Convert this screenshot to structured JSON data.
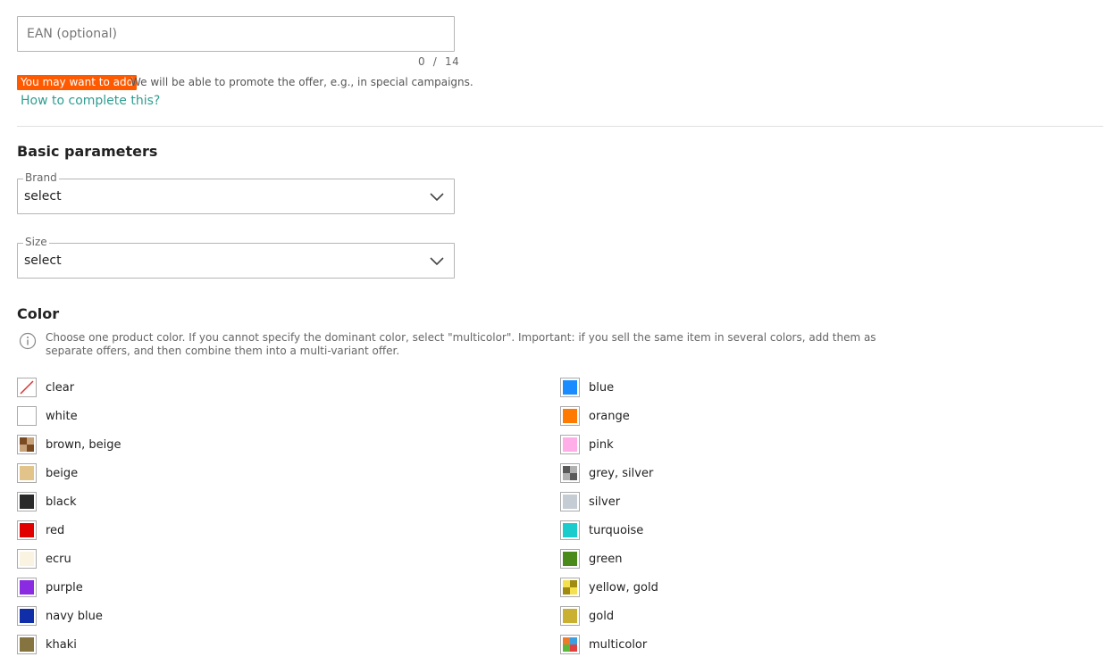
{
  "ean": {
    "placeholder": "EAN (optional)",
    "value": "",
    "counter_current": "0",
    "counter_sep": "/",
    "counter_max": "14",
    "badge": "You may want to add",
    "note": "We will be able to promote the offer, e.g., in special campaigns.",
    "help_link": "How to complete this?"
  },
  "basic_parameters": {
    "title": "Basic parameters",
    "brand": {
      "legend": "Brand",
      "value": "select"
    },
    "size": {
      "legend": "Size",
      "value": "select"
    }
  },
  "color": {
    "title": "Color",
    "info": "Choose one product color. If you cannot specify the dominant color, select \"multicolor\". Important: if you sell the same item in several colors, add them as separate offers, and then combine them into a multi-variant offer.",
    "options": [
      {
        "label": "clear",
        "swatch": "clear-icon",
        "colors": [
          "#ffffff",
          "#e03030"
        ]
      },
      {
        "label": "white",
        "swatch": "solid",
        "colors": [
          "#ffffff"
        ]
      },
      {
        "label": "brown, beige",
        "swatch": "checker",
        "colors": [
          "#7a4a22",
          "#c8a27a"
        ]
      },
      {
        "label": "beige",
        "swatch": "solid",
        "colors": [
          "#e2c48a"
        ]
      },
      {
        "label": "black",
        "swatch": "solid",
        "colors": [
          "#2a2a2a"
        ]
      },
      {
        "label": "red",
        "swatch": "solid",
        "colors": [
          "#e00000"
        ]
      },
      {
        "label": "ecru",
        "swatch": "solid",
        "colors": [
          "#fbf3e2"
        ]
      },
      {
        "label": "purple",
        "swatch": "solid",
        "colors": [
          "#8a2be2"
        ]
      },
      {
        "label": "navy blue",
        "swatch": "solid",
        "colors": [
          "#0f2ea8"
        ]
      },
      {
        "label": "khaki",
        "swatch": "solid",
        "colors": [
          "#857340"
        ]
      },
      {
        "label": "blue",
        "swatch": "solid",
        "colors": [
          "#1a8cff"
        ]
      },
      {
        "label": "orange",
        "swatch": "solid",
        "colors": [
          "#ff7a00"
        ]
      },
      {
        "label": "pink",
        "swatch": "solid",
        "colors": [
          "#ffaee8"
        ]
      },
      {
        "label": "grey, silver",
        "swatch": "checker",
        "colors": [
          "#5a5a5a",
          "#b0b0b0"
        ]
      },
      {
        "label": "silver",
        "swatch": "solid",
        "colors": [
          "#c5ccd4"
        ]
      },
      {
        "label": "turquoise",
        "swatch": "solid",
        "colors": [
          "#1ccccc"
        ]
      },
      {
        "label": "green",
        "swatch": "solid",
        "colors": [
          "#4a8a1a"
        ]
      },
      {
        "label": "yellow, gold",
        "swatch": "checker",
        "colors": [
          "#f5e050",
          "#a08a10"
        ]
      },
      {
        "label": "gold",
        "swatch": "solid",
        "colors": [
          "#c9b030"
        ]
      },
      {
        "label": "multicolor",
        "swatch": "quad",
        "colors": [
          "#f07a2a",
          "#3aa0e0",
          "#5ab83a",
          "#e04040"
        ]
      }
    ]
  },
  "colors": {
    "accent": "#ff5a00",
    "link": "#2f9d91",
    "border": "#b5b5b5"
  }
}
